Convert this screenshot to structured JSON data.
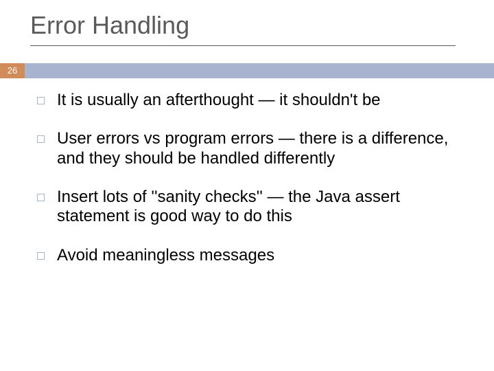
{
  "slide": {
    "title": "Error Handling",
    "page_number": "26",
    "bullets": [
      "It is usually an afterthought — it shouldn't be",
      "User errors vs program errors — there is a difference, and they should be handled differently",
      "Insert lots of ''sanity checks'' — the Java assert statement is good way to do this",
      "Avoid meaningless messages"
    ]
  },
  "colors": {
    "accent_orange": "#d28b5b",
    "accent_blue": "#a8b3cf",
    "title_gray": "#595959"
  }
}
